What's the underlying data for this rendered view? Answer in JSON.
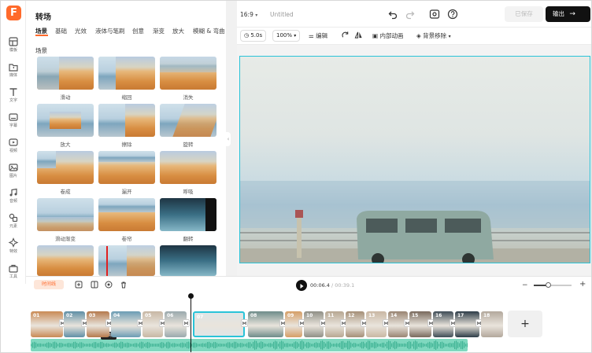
{
  "app": {
    "logo_letter": "F"
  },
  "rail": {
    "items": [
      {
        "label": "模板",
        "icon": "template-icon"
      },
      {
        "label": "媒体",
        "icon": "media-icon"
      },
      {
        "label": "文字",
        "icon": "text-icon"
      },
      {
        "label": "字幕",
        "icon": "subtitle-icon"
      },
      {
        "label": "视频",
        "icon": "video-icon"
      },
      {
        "label": "图片",
        "icon": "image-icon"
      },
      {
        "label": "音频",
        "icon": "audio-icon"
      },
      {
        "label": "元素",
        "icon": "elements-icon"
      },
      {
        "label": "特效",
        "icon": "effects-icon"
      },
      {
        "label": "工具",
        "icon": "tools-icon"
      }
    ]
  },
  "panel": {
    "title": "转场",
    "tabs": [
      "场景",
      "基础",
      "光效",
      "液体与笔刷",
      "创意",
      "渐变",
      "放大",
      "模糊 & 弯曲"
    ],
    "section": "场景",
    "tiles": [
      "滑动",
      "缩回",
      "消失",
      "放大",
      "擦除",
      "旋转",
      "卷成",
      "漏开",
      "呼吸",
      "滑动渐变",
      "卷帘",
      "翻转",
      "",
      "",
      ""
    ]
  },
  "header": {
    "ratio": "16:9",
    "title": "Untitled",
    "saved_label": "已保存",
    "export_label": "输出"
  },
  "toolbar": {
    "duration": "5.0s",
    "zoom": "100%",
    "edit": "编辑",
    "inner_anim": "内部动画",
    "bg_remove": "背景移除"
  },
  "timeline": {
    "tag": "时间线",
    "current": "00:06.4",
    "total": "00:39.1",
    "tooltip": "转场",
    "clips": [
      "01",
      "02",
      "03",
      "04",
      "05",
      "06",
      "07",
      "08",
      "09",
      "10",
      "11",
      "12",
      "13",
      "14",
      "15",
      "16",
      "17",
      "18"
    ]
  },
  "colors": {
    "accent": "#ff6a2b",
    "selection": "#29c3d8",
    "export_bg": "#111111",
    "audio": "#7fd8bf"
  }
}
